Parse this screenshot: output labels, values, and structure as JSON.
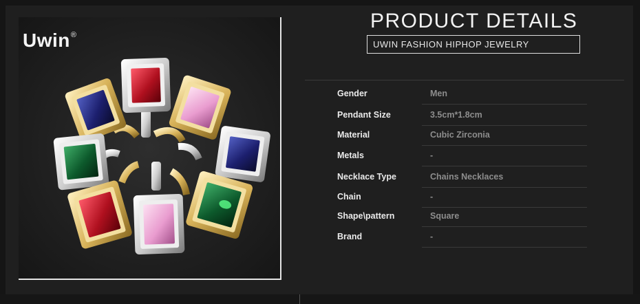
{
  "brand": {
    "logo_text": "Uwin",
    "registered_mark": "®"
  },
  "header": {
    "title": "PRODUCT DETAILS",
    "subtitle": "UWIN FASHION HIPHOP JEWELRY"
  },
  "details": [
    {
      "label": "Gender",
      "value": "Men"
    },
    {
      "label": "Pendant Size",
      "value": "3.5cm*1.8cm"
    },
    {
      "label": "Material",
      "value": "Cubic Zirconia"
    },
    {
      "label": "Metals",
      "value": "-"
    },
    {
      "label": "Necklace Type",
      "value": "Chains Necklaces"
    },
    {
      "label": "Chain",
      "value": "-"
    },
    {
      "label": "Shape\\pattern",
      "value": "Square"
    },
    {
      "label": "Brand",
      "value": "-"
    }
  ],
  "colors": {
    "background": "#1f1f1f",
    "text_primary": "#eaeaea",
    "text_secondary": "#8d8d8d",
    "gem_ruby": "#b0101f",
    "gem_pink": "#e99ccf",
    "gem_sapphire": "#1c1f6e",
    "gem_emerald": "#0d5a2c",
    "metal_gold": "#d8b35a",
    "metal_silver": "#d4d4d4"
  }
}
